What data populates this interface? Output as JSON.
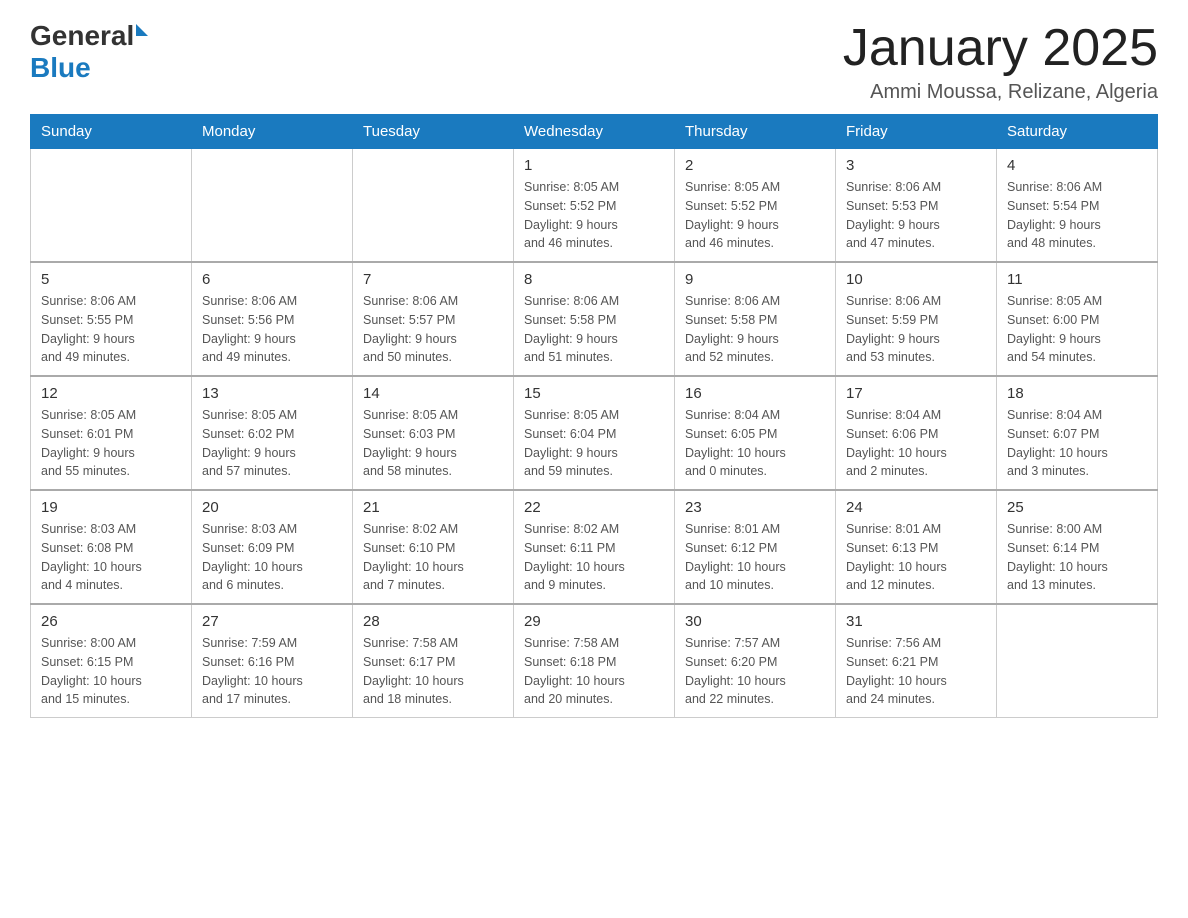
{
  "header": {
    "logo_general": "General",
    "logo_blue": "Blue",
    "title": "January 2025",
    "subtitle": "Ammi Moussa, Relizane, Algeria"
  },
  "weekdays": [
    "Sunday",
    "Monday",
    "Tuesday",
    "Wednesday",
    "Thursday",
    "Friday",
    "Saturday"
  ],
  "weeks": [
    [
      {
        "day": "",
        "info": ""
      },
      {
        "day": "",
        "info": ""
      },
      {
        "day": "",
        "info": ""
      },
      {
        "day": "1",
        "info": "Sunrise: 8:05 AM\nSunset: 5:52 PM\nDaylight: 9 hours\nand 46 minutes."
      },
      {
        "day": "2",
        "info": "Sunrise: 8:05 AM\nSunset: 5:52 PM\nDaylight: 9 hours\nand 46 minutes."
      },
      {
        "day": "3",
        "info": "Sunrise: 8:06 AM\nSunset: 5:53 PM\nDaylight: 9 hours\nand 47 minutes."
      },
      {
        "day": "4",
        "info": "Sunrise: 8:06 AM\nSunset: 5:54 PM\nDaylight: 9 hours\nand 48 minutes."
      }
    ],
    [
      {
        "day": "5",
        "info": "Sunrise: 8:06 AM\nSunset: 5:55 PM\nDaylight: 9 hours\nand 49 minutes."
      },
      {
        "day": "6",
        "info": "Sunrise: 8:06 AM\nSunset: 5:56 PM\nDaylight: 9 hours\nand 49 minutes."
      },
      {
        "day": "7",
        "info": "Sunrise: 8:06 AM\nSunset: 5:57 PM\nDaylight: 9 hours\nand 50 minutes."
      },
      {
        "day": "8",
        "info": "Sunrise: 8:06 AM\nSunset: 5:58 PM\nDaylight: 9 hours\nand 51 minutes."
      },
      {
        "day": "9",
        "info": "Sunrise: 8:06 AM\nSunset: 5:58 PM\nDaylight: 9 hours\nand 52 minutes."
      },
      {
        "day": "10",
        "info": "Sunrise: 8:06 AM\nSunset: 5:59 PM\nDaylight: 9 hours\nand 53 minutes."
      },
      {
        "day": "11",
        "info": "Sunrise: 8:05 AM\nSunset: 6:00 PM\nDaylight: 9 hours\nand 54 minutes."
      }
    ],
    [
      {
        "day": "12",
        "info": "Sunrise: 8:05 AM\nSunset: 6:01 PM\nDaylight: 9 hours\nand 55 minutes."
      },
      {
        "day": "13",
        "info": "Sunrise: 8:05 AM\nSunset: 6:02 PM\nDaylight: 9 hours\nand 57 minutes."
      },
      {
        "day": "14",
        "info": "Sunrise: 8:05 AM\nSunset: 6:03 PM\nDaylight: 9 hours\nand 58 minutes."
      },
      {
        "day": "15",
        "info": "Sunrise: 8:05 AM\nSunset: 6:04 PM\nDaylight: 9 hours\nand 59 minutes."
      },
      {
        "day": "16",
        "info": "Sunrise: 8:04 AM\nSunset: 6:05 PM\nDaylight: 10 hours\nand 0 minutes."
      },
      {
        "day": "17",
        "info": "Sunrise: 8:04 AM\nSunset: 6:06 PM\nDaylight: 10 hours\nand 2 minutes."
      },
      {
        "day": "18",
        "info": "Sunrise: 8:04 AM\nSunset: 6:07 PM\nDaylight: 10 hours\nand 3 minutes."
      }
    ],
    [
      {
        "day": "19",
        "info": "Sunrise: 8:03 AM\nSunset: 6:08 PM\nDaylight: 10 hours\nand 4 minutes."
      },
      {
        "day": "20",
        "info": "Sunrise: 8:03 AM\nSunset: 6:09 PM\nDaylight: 10 hours\nand 6 minutes."
      },
      {
        "day": "21",
        "info": "Sunrise: 8:02 AM\nSunset: 6:10 PM\nDaylight: 10 hours\nand 7 minutes."
      },
      {
        "day": "22",
        "info": "Sunrise: 8:02 AM\nSunset: 6:11 PM\nDaylight: 10 hours\nand 9 minutes."
      },
      {
        "day": "23",
        "info": "Sunrise: 8:01 AM\nSunset: 6:12 PM\nDaylight: 10 hours\nand 10 minutes."
      },
      {
        "day": "24",
        "info": "Sunrise: 8:01 AM\nSunset: 6:13 PM\nDaylight: 10 hours\nand 12 minutes."
      },
      {
        "day": "25",
        "info": "Sunrise: 8:00 AM\nSunset: 6:14 PM\nDaylight: 10 hours\nand 13 minutes."
      }
    ],
    [
      {
        "day": "26",
        "info": "Sunrise: 8:00 AM\nSunset: 6:15 PM\nDaylight: 10 hours\nand 15 minutes."
      },
      {
        "day": "27",
        "info": "Sunrise: 7:59 AM\nSunset: 6:16 PM\nDaylight: 10 hours\nand 17 minutes."
      },
      {
        "day": "28",
        "info": "Sunrise: 7:58 AM\nSunset: 6:17 PM\nDaylight: 10 hours\nand 18 minutes."
      },
      {
        "day": "29",
        "info": "Sunrise: 7:58 AM\nSunset: 6:18 PM\nDaylight: 10 hours\nand 20 minutes."
      },
      {
        "day": "30",
        "info": "Sunrise: 7:57 AM\nSunset: 6:20 PM\nDaylight: 10 hours\nand 22 minutes."
      },
      {
        "day": "31",
        "info": "Sunrise: 7:56 AM\nSunset: 6:21 PM\nDaylight: 10 hours\nand 24 minutes."
      },
      {
        "day": "",
        "info": ""
      }
    ]
  ]
}
